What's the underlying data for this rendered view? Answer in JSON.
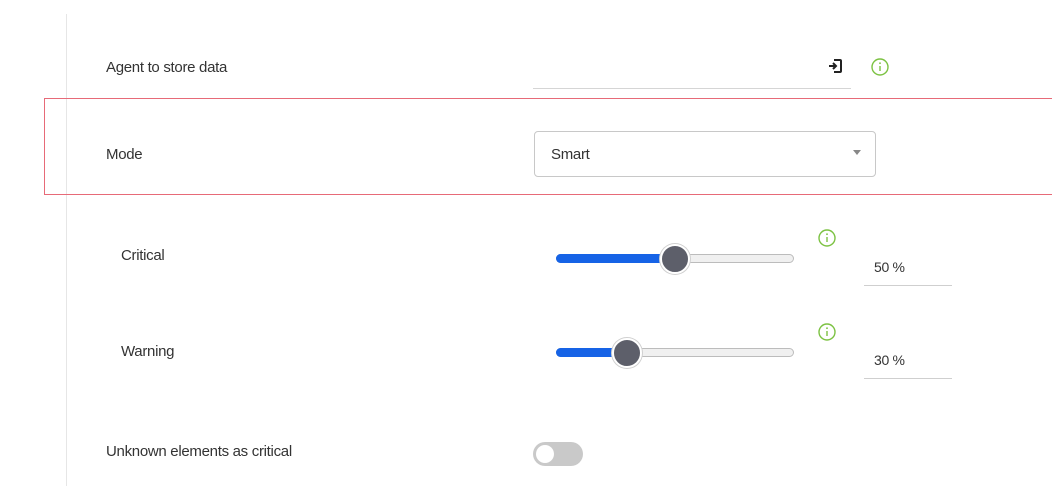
{
  "form": {
    "agent": {
      "label": "Agent to store data",
      "value": "",
      "icon": "login-icon",
      "info_icon": "info-icon"
    },
    "mode": {
      "label": "Mode",
      "selected": "Smart"
    },
    "critical": {
      "label": "Critical",
      "value": 50,
      "value_text": "50 %"
    },
    "warning": {
      "label": "Warning",
      "value": 30,
      "value_text": "30 %"
    },
    "unknown_critical": {
      "label": "Unknown elements as critical",
      "enabled": false
    }
  },
  "colors": {
    "accent": "#1663e6",
    "info": "#7cc242",
    "highlight_border": "#e76a78",
    "thumb": "#5d5f6a",
    "toggle_off": "#c9c9c9"
  }
}
